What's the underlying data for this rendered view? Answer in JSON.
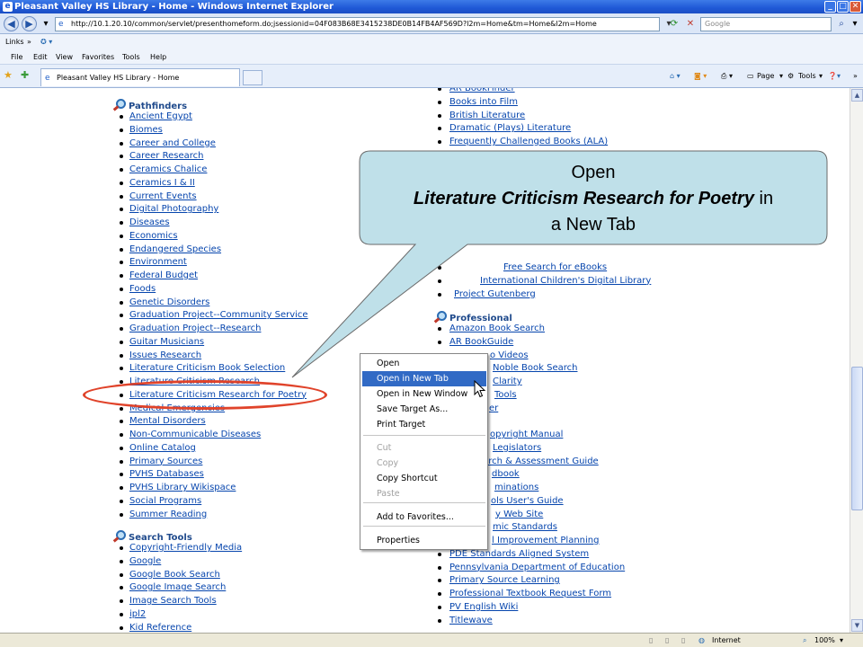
{
  "window": {
    "title": "Pleasant Valley HS Library - Home - Windows Internet Explorer",
    "controls": {
      "minimize": "_",
      "maximize": "□",
      "close": "✕"
    }
  },
  "addressbar": {
    "url": "http://10.1.20.10/common/servlet/presenthomeform.do;jsessionid=04F083B68E3415238DE0B14FB4AF569D?l2m=Home&tm=Home&l2m=Home",
    "search_placeholder": "Google"
  },
  "linksbar": {
    "label": "Links"
  },
  "menubar": [
    "File",
    "Edit",
    "View",
    "Favorites",
    "Tools",
    "Help"
  ],
  "tab": {
    "title": "Pleasant Valley HS Library - Home"
  },
  "commandbar": {
    "page": "Page",
    "tools": "Tools"
  },
  "left_column": {
    "pathfinders": {
      "heading": "Pathfinders",
      "links": [
        "Ancient Egypt",
        "Biomes",
        "Career and College",
        "Career Research",
        "Ceramics Chalice",
        "Ceramics I & II",
        "Current Events",
        "Digital Photography",
        "Diseases",
        "Economics",
        "Endangered Species",
        "Environment",
        "Federal Budget",
        "Foods",
        "Genetic Disorders",
        "Graduation Project--Community Service",
        "Graduation Project--Research",
        "Guitar Musicians",
        "Issues Research",
        "Literature Criticism Book Selection",
        "Literature Criticism Research",
        "Literature Criticism Research for Poetry",
        "Medical Emergencies",
        "Mental Disorders",
        "Non-Communicable Diseases",
        "Online Catalog",
        "Primary Sources",
        "PVHS Databases",
        "PVHS Library Wikispace",
        "Social Programs",
        "Summer Reading"
      ]
    },
    "search_tools": {
      "heading": "Search Tools",
      "links": [
        "Copyright-Friendly Media",
        "Google",
        "Google Book Search",
        "Google Image Search",
        "Image Search Tools",
        "ipl2",
        "Kid Reference"
      ]
    }
  },
  "right_column": {
    "top_links": [
      "AR BookFinder",
      "Books into Film",
      "British Literature",
      "Dramatic (Plays) Literature",
      "Frequently Challenged Books (ALA)"
    ],
    "partial_links": [
      {
        "text": "Free Search for eBooks"
      },
      {
        "text": "International Children's Digital Library"
      },
      {
        "text": "Project Gutenberg"
      }
    ],
    "professional": {
      "heading": "Professional",
      "links": [
        {
          "text": "Amazon Book Search"
        },
        {
          "text": "AR BookGuide"
        },
        {
          "text": "o Videos"
        },
        {
          "text": "Noble Book Search"
        },
        {
          "text": "Clarity"
        },
        {
          "text": "Tools"
        },
        {
          "text": "er"
        },
        {
          "text": ""
        },
        {
          "text": "opyright Manual"
        },
        {
          "text": "Legislators"
        },
        {
          "text": "earch & Assessment Guide"
        },
        {
          "text": "dbook"
        },
        {
          "text": "minations"
        },
        {
          "text": "ols User's Guide"
        },
        {
          "text": "y Web Site"
        },
        {
          "text": "mic Standards"
        },
        {
          "text": "l Improvement Planning"
        },
        {
          "text": "PDE Standards Aligned System"
        },
        {
          "text": "Pennsylvania Department of Education"
        },
        {
          "text": "Primary Source Learning"
        },
        {
          "text": "Professional Textbook Request Form"
        },
        {
          "text": "PV English Wiki"
        },
        {
          "text": "Titlewave"
        }
      ]
    }
  },
  "context_menu": {
    "items": [
      {
        "label": "Open",
        "state": "normal"
      },
      {
        "label": "Open in New Tab",
        "state": "selected"
      },
      {
        "label": "Open in New Window",
        "state": "normal"
      },
      {
        "label": "Save Target As...",
        "state": "normal"
      },
      {
        "label": "Print Target",
        "state": "normal"
      },
      {
        "label": "Cut",
        "state": "disabled"
      },
      {
        "label": "Copy",
        "state": "disabled"
      },
      {
        "label": "Copy Shortcut",
        "state": "normal"
      },
      {
        "label": "Paste",
        "state": "disabled"
      },
      {
        "label": "Add to Favorites...",
        "state": "normal"
      },
      {
        "label": "Properties",
        "state": "normal"
      }
    ]
  },
  "callout": {
    "line1": "Open",
    "emphasis": "Literature Criticism Research for Poetry",
    "after_emphasis": " in",
    "line3": "a New Tab"
  },
  "statusbar": {
    "zone": "Internet",
    "zoom": "100%"
  },
  "colors": {
    "link": "#0645ad",
    "heading": "#1f4a8c",
    "selection": "#316ac5",
    "callout_fill": "#bfe0e9",
    "highlight": "#e0432a"
  }
}
